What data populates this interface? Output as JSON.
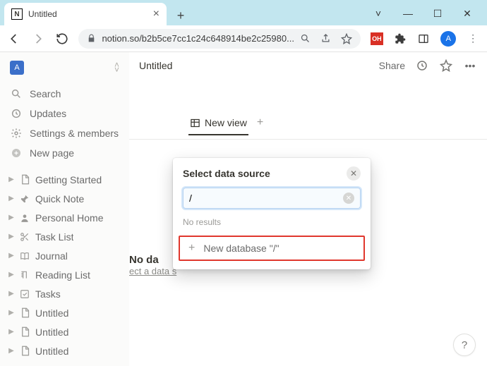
{
  "browser": {
    "tab_title": "Untitled",
    "url": "notion.so/b2b5ce7cc1c24c648914be2c25980...",
    "avatar_letter": "A",
    "ext_label": "OH"
  },
  "sidebar": {
    "workspace_letter": "A",
    "nav": [
      {
        "icon": "search-icon",
        "label": "Search"
      },
      {
        "icon": "clock-icon",
        "label": "Updates"
      },
      {
        "icon": "gear-icon",
        "label": "Settings & members"
      },
      {
        "icon": "plus-circle-icon",
        "label": "New page"
      }
    ],
    "pages": [
      {
        "icon": "document-icon",
        "label": "Getting Started"
      },
      {
        "icon": "pin-icon",
        "label": "Quick Note"
      },
      {
        "icon": "person-icon",
        "label": "Personal Home"
      },
      {
        "icon": "scissors-icon",
        "label": "Task List"
      },
      {
        "icon": "book-icon",
        "label": "Journal"
      },
      {
        "icon": "bookmark-icon",
        "label": "Reading List"
      },
      {
        "icon": "check-icon",
        "label": "Tasks"
      },
      {
        "icon": "document-icon",
        "label": "Untitled"
      },
      {
        "icon": "document-icon",
        "label": "Untitled"
      },
      {
        "icon": "document-icon",
        "label": "Untitled"
      }
    ]
  },
  "topbar": {
    "breadcrumb": "Untitled",
    "share": "Share"
  },
  "content": {
    "view_tab": "New view",
    "no_data": "No da",
    "select_hint": "ect a data s"
  },
  "popover": {
    "title": "Select data source",
    "search_value": "/",
    "no_results": "No results",
    "new_db_label": "New database \"/\""
  },
  "help": "?"
}
